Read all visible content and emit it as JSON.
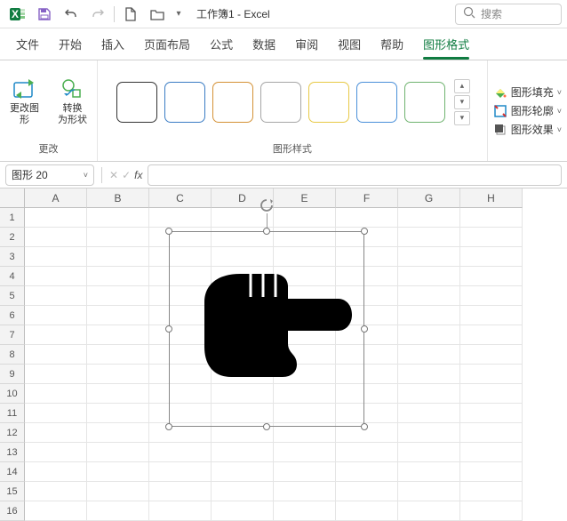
{
  "titlebar": {
    "workbook": "工作簿1",
    "app": "Excel",
    "sep": " - ",
    "search_placeholder": "搜索"
  },
  "tabs": {
    "file": "文件",
    "home": "开始",
    "insert": "插入",
    "layout": "页面布局",
    "formula": "公式",
    "data": "数据",
    "review": "审阅",
    "view": "视图",
    "help": "帮助",
    "shapeformat": "图形格式"
  },
  "ribbon": {
    "change_group": "更改",
    "change_shape": "更改图\n形",
    "convert_shape": "转换\n为形状",
    "styles_group": "图形样式",
    "fill": "图形填充",
    "outline": "图形轮廓",
    "effects": "图形效果",
    "swatch_colors": [
      "#333333",
      "#3a7cc4",
      "#d49135",
      "#a6a6a6",
      "#e7c945",
      "#4a90d9",
      "#6fb36f"
    ]
  },
  "namebox": {
    "value": "图形 20"
  },
  "grid": {
    "cols": [
      "A",
      "B",
      "C",
      "D",
      "E",
      "F",
      "G",
      "H"
    ],
    "rows": 16
  }
}
